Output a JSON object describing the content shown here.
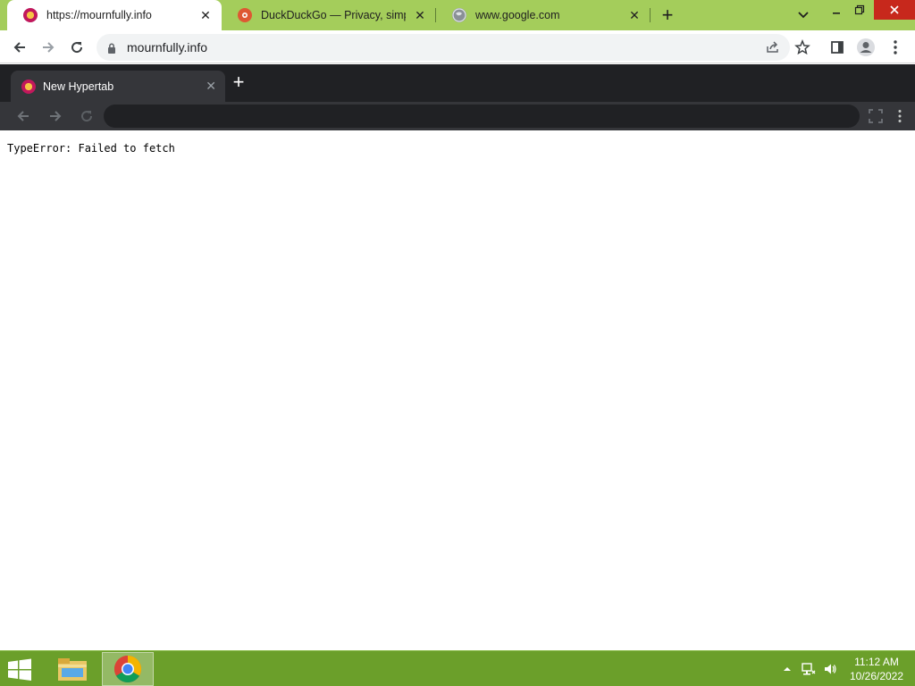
{
  "outer_browser": {
    "tabs": [
      {
        "title": "https://mournfully.info",
        "favicon": "hypertab-icon",
        "active": true
      },
      {
        "title": "DuckDuckGo — Privacy, simplifie",
        "favicon": "duckduckgo-icon",
        "active": false
      },
      {
        "title": "www.google.com",
        "favicon": "globe-icon",
        "active": false
      }
    ],
    "address": "mournfully.info",
    "accent_color": "#a4cd5b"
  },
  "inner_browser": {
    "tab_title": "New Hypertab",
    "address": "",
    "theme_color": "#202124"
  },
  "page": {
    "error_message": "TypeError: Failed to fetch"
  },
  "taskbar": {
    "time": "11:12 AM",
    "date": "10/26/2022",
    "color": "#6b9f2a"
  }
}
